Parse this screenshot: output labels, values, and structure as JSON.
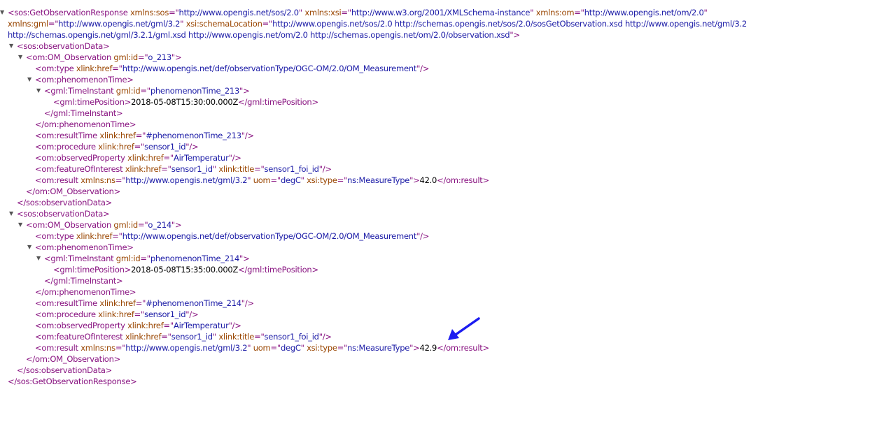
{
  "xml_tree": [
    {
      "d": 0,
      "t": 1,
      "wrap": 1,
      "p": [
        [
          "tag",
          "<sos:GetObservationResponse "
        ],
        [
          "an",
          "xmlns:sos"
        ],
        [
          "tag",
          "=\""
        ],
        [
          "av",
          "http://www.opengis.net/sos/2.0"
        ],
        [
          "tag",
          "\" "
        ],
        [
          "an",
          "xmlns:xsi"
        ],
        [
          "tag",
          "=\""
        ],
        [
          "av",
          "http://www.w3.org/2001/XMLSchema-instance"
        ],
        [
          "tag",
          "\" "
        ],
        [
          "an",
          "xmlns:om"
        ],
        [
          "tag",
          "=\""
        ],
        [
          "av",
          "http://www.opengis.net/om/2.0"
        ],
        [
          "tag",
          "\" "
        ],
        [
          "an",
          "xmlns:gml"
        ],
        [
          "tag",
          "=\""
        ],
        [
          "av",
          "http://www.opengis.net/gml/3.2"
        ],
        [
          "tag",
          "\" "
        ],
        [
          "an",
          "xsi:schemaLocation"
        ],
        [
          "tag",
          "=\""
        ],
        [
          "av",
          "http://www.opengis.net/sos/2.0 http://schemas.opengis.net/sos/2.0/sosGetObservation.xsd http://www.opengis.net/gml/3.2 http://schemas.opengis.net/gml/3.2.1/gml.xsd http://www.opengis.net/om/2.0 http://schemas.opengis.net/om/2.0/observation.xsd"
        ],
        [
          "tag",
          "\">"
        ]
      ]
    },
    {
      "d": 1,
      "t": 1,
      "p": [
        [
          "tag",
          "<sos:observationData>"
        ]
      ]
    },
    {
      "d": 2,
      "t": 1,
      "p": [
        [
          "tag",
          "<om:OM_Observation "
        ],
        [
          "an",
          "gml:id"
        ],
        [
          "tag",
          "=\""
        ],
        [
          "av",
          "o_213"
        ],
        [
          "tag",
          "\">"
        ]
      ]
    },
    {
      "d": 3,
      "t": 0,
      "p": [
        [
          "tag",
          "<om:type "
        ],
        [
          "an",
          "xlink:href"
        ],
        [
          "tag",
          "=\""
        ],
        [
          "av",
          "http://www.opengis.net/def/observationType/OGC-OM/2.0/OM_Measurement"
        ],
        [
          "tag",
          "\"/>"
        ]
      ]
    },
    {
      "d": 3,
      "t": 1,
      "p": [
        [
          "tag",
          "<om:phenomenonTime>"
        ]
      ]
    },
    {
      "d": 4,
      "t": 1,
      "p": [
        [
          "tag",
          "<gml:TimeInstant "
        ],
        [
          "an",
          "gml:id"
        ],
        [
          "tag",
          "=\""
        ],
        [
          "av",
          "phenomenonTime_213"
        ],
        [
          "tag",
          "\">"
        ]
      ]
    },
    {
      "d": 5,
      "t": 0,
      "p": [
        [
          "tag",
          "<gml:timePosition>"
        ],
        [
          "tx",
          "2018-05-08T15:30:00.000Z"
        ],
        [
          "tag",
          "</gml:timePosition>"
        ]
      ]
    },
    {
      "d": 4,
      "t": 0,
      "p": [
        [
          "tag",
          "</gml:TimeInstant>"
        ]
      ]
    },
    {
      "d": 3,
      "t": 0,
      "p": [
        [
          "tag",
          "</om:phenomenonTime>"
        ]
      ]
    },
    {
      "d": 3,
      "t": 0,
      "p": [
        [
          "tag",
          "<om:resultTime "
        ],
        [
          "an",
          "xlink:href"
        ],
        [
          "tag",
          "=\""
        ],
        [
          "av",
          "#phenomenonTime_213"
        ],
        [
          "tag",
          "\"/>"
        ]
      ]
    },
    {
      "d": 3,
      "t": 0,
      "p": [
        [
          "tag",
          "<om:procedure "
        ],
        [
          "an",
          "xlink:href"
        ],
        [
          "tag",
          "=\""
        ],
        [
          "av",
          "sensor1_id"
        ],
        [
          "tag",
          "\"/>"
        ]
      ]
    },
    {
      "d": 3,
      "t": 0,
      "p": [
        [
          "tag",
          "<om:observedProperty "
        ],
        [
          "an",
          "xlink:href"
        ],
        [
          "tag",
          "=\""
        ],
        [
          "av",
          "AirTemperatur"
        ],
        [
          "tag",
          "\"/>"
        ]
      ]
    },
    {
      "d": 3,
      "t": 0,
      "p": [
        [
          "tag",
          "<om:featureOfInterest "
        ],
        [
          "an",
          "xlink:href"
        ],
        [
          "tag",
          "=\""
        ],
        [
          "av",
          "sensor1_id"
        ],
        [
          "tag",
          "\" "
        ],
        [
          "an",
          "xlink:title"
        ],
        [
          "tag",
          "=\""
        ],
        [
          "av",
          "sensor1_foi_id"
        ],
        [
          "tag",
          "\"/>"
        ]
      ]
    },
    {
      "d": 3,
      "t": 0,
      "p": [
        [
          "tag",
          "<om:result "
        ],
        [
          "an",
          "xmlns:ns"
        ],
        [
          "tag",
          "=\""
        ],
        [
          "av",
          "http://www.opengis.net/gml/3.2"
        ],
        [
          "tag",
          "\" "
        ],
        [
          "an",
          "uom"
        ],
        [
          "tag",
          "=\""
        ],
        [
          "av",
          "degC"
        ],
        [
          "tag",
          "\" "
        ],
        [
          "an",
          "xsi:type"
        ],
        [
          "tag",
          "=\""
        ],
        [
          "av",
          "ns:MeasureType"
        ],
        [
          "tag",
          "\">"
        ],
        [
          "tx",
          "42.0"
        ],
        [
          "tag",
          "</om:result>"
        ]
      ]
    },
    {
      "d": 2,
      "t": 0,
      "p": [
        [
          "tag",
          "</om:OM_Observation>"
        ]
      ]
    },
    {
      "d": 1,
      "t": 0,
      "p": [
        [
          "tag",
          "</sos:observationData>"
        ]
      ]
    },
    {
      "d": 1,
      "t": 1,
      "p": [
        [
          "tag",
          "<sos:observationData>"
        ]
      ]
    },
    {
      "d": 2,
      "t": 1,
      "p": [
        [
          "tag",
          "<om:OM_Observation "
        ],
        [
          "an",
          "gml:id"
        ],
        [
          "tag",
          "=\""
        ],
        [
          "av",
          "o_214"
        ],
        [
          "tag",
          "\">"
        ]
      ]
    },
    {
      "d": 3,
      "t": 0,
      "p": [
        [
          "tag",
          "<om:type "
        ],
        [
          "an",
          "xlink:href"
        ],
        [
          "tag",
          "=\""
        ],
        [
          "av",
          "http://www.opengis.net/def/observationType/OGC-OM/2.0/OM_Measurement"
        ],
        [
          "tag",
          "\"/>"
        ]
      ]
    },
    {
      "d": 3,
      "t": 1,
      "p": [
        [
          "tag",
          "<om:phenomenonTime>"
        ]
      ]
    },
    {
      "d": 4,
      "t": 1,
      "p": [
        [
          "tag",
          "<gml:TimeInstant "
        ],
        [
          "an",
          "gml:id"
        ],
        [
          "tag",
          "=\""
        ],
        [
          "av",
          "phenomenonTime_214"
        ],
        [
          "tag",
          "\">"
        ]
      ]
    },
    {
      "d": 5,
      "t": 0,
      "p": [
        [
          "tag",
          "<gml:timePosition>"
        ],
        [
          "tx",
          "2018-05-08T15:35:00.000Z"
        ],
        [
          "tag",
          "</gml:timePosition>"
        ]
      ]
    },
    {
      "d": 4,
      "t": 0,
      "p": [
        [
          "tag",
          "</gml:TimeInstant>"
        ]
      ]
    },
    {
      "d": 3,
      "t": 0,
      "p": [
        [
          "tag",
          "</om:phenomenonTime>"
        ]
      ]
    },
    {
      "d": 3,
      "t": 0,
      "p": [
        [
          "tag",
          "<om:resultTime "
        ],
        [
          "an",
          "xlink:href"
        ],
        [
          "tag",
          "=\""
        ],
        [
          "av",
          "#phenomenonTime_214"
        ],
        [
          "tag",
          "\"/>"
        ]
      ]
    },
    {
      "d": 3,
      "t": 0,
      "p": [
        [
          "tag",
          "<om:procedure "
        ],
        [
          "an",
          "xlink:href"
        ],
        [
          "tag",
          "=\""
        ],
        [
          "av",
          "sensor1_id"
        ],
        [
          "tag",
          "\"/>"
        ]
      ]
    },
    {
      "d": 3,
      "t": 0,
      "p": [
        [
          "tag",
          "<om:observedProperty "
        ],
        [
          "an",
          "xlink:href"
        ],
        [
          "tag",
          "=\""
        ],
        [
          "av",
          "AirTemperatur"
        ],
        [
          "tag",
          "\"/>"
        ]
      ]
    },
    {
      "d": 3,
      "t": 0,
      "p": [
        [
          "tag",
          "<om:featureOfInterest "
        ],
        [
          "an",
          "xlink:href"
        ],
        [
          "tag",
          "=\""
        ],
        [
          "av",
          "sensor1_id"
        ],
        [
          "tag",
          "\" "
        ],
        [
          "an",
          "xlink:title"
        ],
        [
          "tag",
          "=\""
        ],
        [
          "av",
          "sensor1_foi_id"
        ],
        [
          "tag",
          "\"/>"
        ]
      ]
    },
    {
      "d": 3,
      "t": 0,
      "p": [
        [
          "tag",
          "<om:result "
        ],
        [
          "an",
          "xmlns:ns"
        ],
        [
          "tag",
          "=\""
        ],
        [
          "av",
          "http://www.opengis.net/gml/3.2"
        ],
        [
          "tag",
          "\" "
        ],
        [
          "an",
          "uom"
        ],
        [
          "tag",
          "=\""
        ],
        [
          "av",
          "degC"
        ],
        [
          "tag",
          "\" "
        ],
        [
          "an",
          "xsi:type"
        ],
        [
          "tag",
          "=\""
        ],
        [
          "av",
          "ns:MeasureType"
        ],
        [
          "tag",
          "\">"
        ],
        [
          "tx",
          "42.9"
        ],
        [
          "tag",
          "</om:result>"
        ]
      ]
    },
    {
      "d": 2,
      "t": 0,
      "p": [
        [
          "tag",
          "</om:OM_Observation>"
        ]
      ]
    },
    {
      "d": 1,
      "t": 0,
      "p": [
        [
          "tag",
          "</sos:observationData>"
        ]
      ]
    },
    {
      "d": 0,
      "t": 0,
      "p": [
        [
          "tag",
          "</sos:GetObservationResponse>"
        ]
      ]
    }
  ],
  "toggle_glyph": "▼",
  "colors": {
    "tag": "#881280",
    "attr_name": "#994500",
    "attr_value": "#1a1aa6",
    "text": "#000000",
    "arrow": "#1c1cf0"
  },
  "annotation": {
    "icon": "arrow-icon",
    "points_to_row": 29
  }
}
